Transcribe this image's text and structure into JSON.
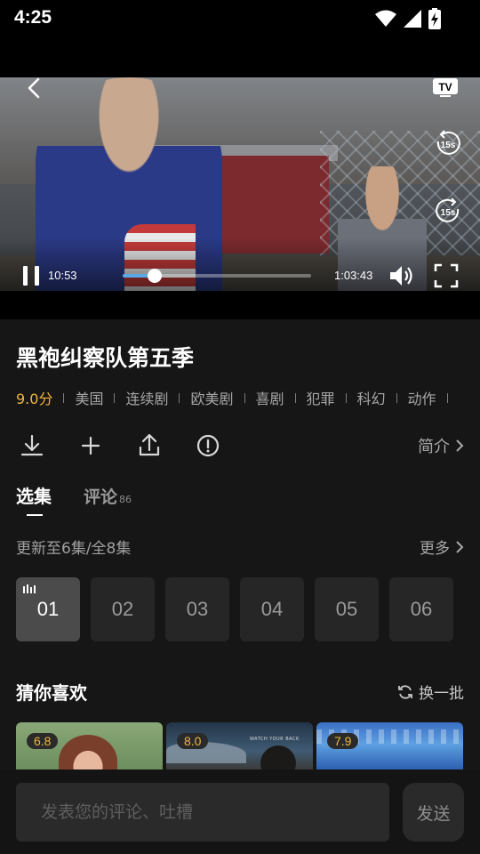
{
  "status_bar": {
    "time": "4:25",
    "icons": [
      "wifi-icon",
      "signal-icon",
      "battery-charging-icon"
    ]
  },
  "player": {
    "current_time": "10:53",
    "total_time": "1:03:43",
    "progress_fraction": 0.17,
    "tv_label": "TV",
    "rewind_label": "15s",
    "forward_label": "15s"
  },
  "show": {
    "title": "黑袍纠察队第五季",
    "score": "9.0分",
    "tags": [
      "美国",
      "连续剧",
      "欧美剧",
      "喜剧",
      "犯罪",
      "科幻",
      "动作"
    ]
  },
  "actions": {
    "intro_label": "简介"
  },
  "tabs": {
    "episodes_label": "选集",
    "comments_label": "评论",
    "comments_count": "86"
  },
  "episodes": {
    "status_text": "更新至6集/全8集",
    "more_label": "更多",
    "list": [
      "01",
      "02",
      "03",
      "04",
      "05",
      "06"
    ],
    "active_index": 0
  },
  "recommend": {
    "title": "猜你喜欢",
    "refresh_label": "换一批",
    "posters": [
      {
        "score": "6.8"
      },
      {
        "score": "8.0",
        "caption": "WATCH YOUR BACK"
      },
      {
        "score": "7.9"
      }
    ]
  },
  "comment_bar": {
    "placeholder": "发表您的评论、吐槽",
    "send_label": "发送"
  },
  "colors": {
    "accent_score": "#f0b63c",
    "progress": "#5aa9e6",
    "background": "#161616"
  }
}
